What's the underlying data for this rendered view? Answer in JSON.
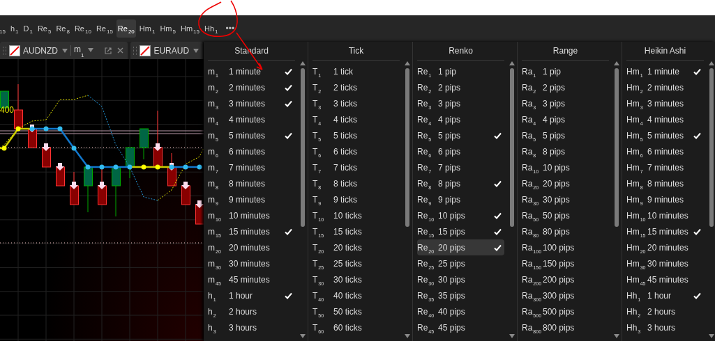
{
  "toolbar": {
    "items": [
      {
        "sub": "15",
        "selected": false
      },
      {
        "prefix": "h",
        "sub": "1",
        "selected": false
      },
      {
        "prefix": "D",
        "sub": "1",
        "selected": false
      },
      {
        "prefix": "Re",
        "sub": "5",
        "selected": false
      },
      {
        "prefix": "Re",
        "sub": "8",
        "selected": false
      },
      {
        "prefix": "Re",
        "sub": "10",
        "selected": false
      },
      {
        "prefix": "Re",
        "sub": "15",
        "selected": false
      },
      {
        "prefix": "Re",
        "sub": "20",
        "selected": true
      },
      {
        "prefix": "Hm",
        "sub": "1",
        "selected": false
      },
      {
        "prefix": "Hm",
        "sub": "5",
        "selected": false
      },
      {
        "prefix": "Hm",
        "sub": "15",
        "selected": false
      },
      {
        "prefix": "Hh",
        "sub": "1",
        "selected": false
      }
    ],
    "more": "•••"
  },
  "chart_tabs": [
    {
      "symbol": "AUDNZD",
      "timeframe_prefix": "m",
      "timeframe_sub": "1"
    },
    {
      "symbol": "EURAUD"
    }
  ],
  "chart": {
    "price_label": "400"
  },
  "menu": {
    "columns": [
      {
        "title": "Standard",
        "items": [
          {
            "prefix": "m",
            "sub": "1",
            "label": "1 minute",
            "checked": true,
            "selected": false
          },
          {
            "prefix": "m",
            "sub": "2",
            "label": "2 minutes",
            "checked": true,
            "selected": false
          },
          {
            "prefix": "m",
            "sub": "3",
            "label": "3 minutes",
            "checked": true,
            "selected": false
          },
          {
            "prefix": "m",
            "sub": "4",
            "label": "4 minutes",
            "checked": false,
            "selected": false
          },
          {
            "prefix": "m",
            "sub": "5",
            "label": "5 minutes",
            "checked": true,
            "selected": false
          },
          {
            "prefix": "m",
            "sub": "6",
            "label": "6 minutes",
            "checked": false,
            "selected": false
          },
          {
            "prefix": "m",
            "sub": "7",
            "label": "7 minutes",
            "checked": false,
            "selected": false
          },
          {
            "prefix": "m",
            "sub": "8",
            "label": "8 minutes",
            "checked": false,
            "selected": false
          },
          {
            "prefix": "m",
            "sub": "9",
            "label": "9 minutes",
            "checked": false,
            "selected": false
          },
          {
            "prefix": "m",
            "sub": "10",
            "label": "10 minutes",
            "checked": false,
            "selected": false
          },
          {
            "prefix": "m",
            "sub": "15",
            "label": "15 minutes",
            "checked": true,
            "selected": false
          },
          {
            "prefix": "m",
            "sub": "20",
            "label": "20 minutes",
            "checked": false,
            "selected": false
          },
          {
            "prefix": "m",
            "sub": "30",
            "label": "30 minutes",
            "checked": false,
            "selected": false
          },
          {
            "prefix": "m",
            "sub": "45",
            "label": "45 minutes",
            "checked": false,
            "selected": false
          },
          {
            "prefix": "h",
            "sub": "1",
            "label": "1 hour",
            "checked": true,
            "selected": false
          },
          {
            "prefix": "h",
            "sub": "2",
            "label": "2 hours",
            "checked": false,
            "selected": false
          },
          {
            "prefix": "h",
            "sub": "3",
            "label": "3 hours",
            "checked": false,
            "selected": false
          }
        ]
      },
      {
        "title": "Tick",
        "items": [
          {
            "prefix": "T",
            "sub": "1",
            "label": "1 tick",
            "checked": false,
            "selected": false
          },
          {
            "prefix": "T",
            "sub": "2",
            "label": "2 ticks",
            "checked": false,
            "selected": false
          },
          {
            "prefix": "T",
            "sub": "3",
            "label": "3 ticks",
            "checked": false,
            "selected": false
          },
          {
            "prefix": "T",
            "sub": "4",
            "label": "4 ticks",
            "checked": false,
            "selected": false
          },
          {
            "prefix": "T",
            "sub": "5",
            "label": "5 ticks",
            "checked": false,
            "selected": false
          },
          {
            "prefix": "T",
            "sub": "6",
            "label": "6 ticks",
            "checked": false,
            "selected": false
          },
          {
            "prefix": "T",
            "sub": "7",
            "label": "7 ticks",
            "checked": false,
            "selected": false
          },
          {
            "prefix": "T",
            "sub": "8",
            "label": "8 ticks",
            "checked": false,
            "selected": false
          },
          {
            "prefix": "T",
            "sub": "9",
            "label": "9 ticks",
            "checked": false,
            "selected": false
          },
          {
            "prefix": "T",
            "sub": "10",
            "label": "10 ticks",
            "checked": false,
            "selected": false
          },
          {
            "prefix": "T",
            "sub": "15",
            "label": "15 ticks",
            "checked": false,
            "selected": false
          },
          {
            "prefix": "T",
            "sub": "20",
            "label": "20 ticks",
            "checked": false,
            "selected": false
          },
          {
            "prefix": "T",
            "sub": "25",
            "label": "25 ticks",
            "checked": false,
            "selected": false
          },
          {
            "prefix": "T",
            "sub": "30",
            "label": "30 ticks",
            "checked": false,
            "selected": false
          },
          {
            "prefix": "T",
            "sub": "40",
            "label": "40 ticks",
            "checked": false,
            "selected": false
          },
          {
            "prefix": "T",
            "sub": "50",
            "label": "50 ticks",
            "checked": false,
            "selected": false
          },
          {
            "prefix": "T",
            "sub": "60",
            "label": "60 ticks",
            "checked": false,
            "selected": false
          }
        ]
      },
      {
        "title": "Renko",
        "items": [
          {
            "prefix": "Re",
            "sub": "1",
            "label": "1 pip",
            "checked": false,
            "selected": false
          },
          {
            "prefix": "Re",
            "sub": "2",
            "label": "2 pips",
            "checked": false,
            "selected": false
          },
          {
            "prefix": "Re",
            "sub": "3",
            "label": "3 pips",
            "checked": false,
            "selected": false
          },
          {
            "prefix": "Re",
            "sub": "4",
            "label": "4 pips",
            "checked": false,
            "selected": false
          },
          {
            "prefix": "Re",
            "sub": "5",
            "label": "5 pips",
            "checked": true,
            "selected": false
          },
          {
            "prefix": "Re",
            "sub": "6",
            "label": "6 pips",
            "checked": false,
            "selected": false
          },
          {
            "prefix": "Re",
            "sub": "7",
            "label": "7 pips",
            "checked": false,
            "selected": false
          },
          {
            "prefix": "Re",
            "sub": "8",
            "label": "8 pips",
            "checked": true,
            "selected": false
          },
          {
            "prefix": "Re",
            "sub": "9",
            "label": "9 pips",
            "checked": false,
            "selected": false
          },
          {
            "prefix": "Re",
            "sub": "10",
            "label": "10 pips",
            "checked": true,
            "selected": false
          },
          {
            "prefix": "Re",
            "sub": "15",
            "label": "15 pips",
            "checked": true,
            "selected": false
          },
          {
            "prefix": "Re",
            "sub": "20",
            "label": "20 pips",
            "checked": true,
            "selected": true
          },
          {
            "prefix": "Re",
            "sub": "25",
            "label": "25 pips",
            "checked": false,
            "selected": false
          },
          {
            "prefix": "Re",
            "sub": "30",
            "label": "30 pips",
            "checked": false,
            "selected": false
          },
          {
            "prefix": "Re",
            "sub": "35",
            "label": "35 pips",
            "checked": false,
            "selected": false
          },
          {
            "prefix": "Re",
            "sub": "40",
            "label": "40 pips",
            "checked": false,
            "selected": false
          },
          {
            "prefix": "Re",
            "sub": "45",
            "label": "45 pips",
            "checked": false,
            "selected": false
          }
        ]
      },
      {
        "title": "Range",
        "items": [
          {
            "prefix": "Ra",
            "sub": "1",
            "label": "1 pip",
            "checked": false,
            "selected": false
          },
          {
            "prefix": "Ra",
            "sub": "2",
            "label": "2 pips",
            "checked": false,
            "selected": false
          },
          {
            "prefix": "Ra",
            "sub": "3",
            "label": "3 pips",
            "checked": false,
            "selected": false
          },
          {
            "prefix": "Ra",
            "sub": "4",
            "label": "4 pips",
            "checked": false,
            "selected": false
          },
          {
            "prefix": "Ra",
            "sub": "5",
            "label": "5 pips",
            "checked": false,
            "selected": false
          },
          {
            "prefix": "Ra",
            "sub": "8",
            "label": "8 pips",
            "checked": false,
            "selected": false
          },
          {
            "prefix": "Ra",
            "sub": "10",
            "label": "10 pips",
            "checked": false,
            "selected": false
          },
          {
            "prefix": "Ra",
            "sub": "20",
            "label": "20 pips",
            "checked": false,
            "selected": false
          },
          {
            "prefix": "Ra",
            "sub": "30",
            "label": "30 pips",
            "checked": false,
            "selected": false
          },
          {
            "prefix": "Ra",
            "sub": "50",
            "label": "50 pips",
            "checked": false,
            "selected": false
          },
          {
            "prefix": "Ra",
            "sub": "80",
            "label": "80 pips",
            "checked": false,
            "selected": false
          },
          {
            "prefix": "Ra",
            "sub": "100",
            "label": "100 pips",
            "checked": false,
            "selected": false
          },
          {
            "prefix": "Ra",
            "sub": "150",
            "label": "150 pips",
            "checked": false,
            "selected": false
          },
          {
            "prefix": "Ra",
            "sub": "200",
            "label": "200 pips",
            "checked": false,
            "selected": false
          },
          {
            "prefix": "Ra",
            "sub": "300",
            "label": "300 pips",
            "checked": false,
            "selected": false
          },
          {
            "prefix": "Ra",
            "sub": "500",
            "label": "500 pips",
            "checked": false,
            "selected": false
          },
          {
            "prefix": "Ra",
            "sub": "800",
            "label": "800 pips",
            "checked": false,
            "selected": false
          }
        ]
      },
      {
        "title": "Heikin Ashi",
        "items": [
          {
            "prefix": "Hm",
            "sub": "1",
            "label": "1 minute",
            "checked": true,
            "selected": false
          },
          {
            "prefix": "Hm",
            "sub": "2",
            "label": "2 minutes",
            "checked": false,
            "selected": false
          },
          {
            "prefix": "Hm",
            "sub": "3",
            "label": "3 minutes",
            "checked": false,
            "selected": false
          },
          {
            "prefix": "Hm",
            "sub": "4",
            "label": "4 minutes",
            "checked": false,
            "selected": false
          },
          {
            "prefix": "Hm",
            "sub": "5",
            "label": "5 minutes",
            "checked": true,
            "selected": false
          },
          {
            "prefix": "Hm",
            "sub": "6",
            "label": "6 minutes",
            "checked": false,
            "selected": false
          },
          {
            "prefix": "Hm",
            "sub": "7",
            "label": "7 minutes",
            "checked": false,
            "selected": false
          },
          {
            "prefix": "Hm",
            "sub": "8",
            "label": "8 minutes",
            "checked": false,
            "selected": false
          },
          {
            "prefix": "Hm",
            "sub": "9",
            "label": "9 minutes",
            "checked": false,
            "selected": false
          },
          {
            "prefix": "Hm",
            "sub": "10",
            "label": "10 minutes",
            "checked": false,
            "selected": false
          },
          {
            "prefix": "Hm",
            "sub": "15",
            "label": "15 minutes",
            "checked": true,
            "selected": false
          },
          {
            "prefix": "Hm",
            "sub": "20",
            "label": "20 minutes",
            "checked": false,
            "selected": false
          },
          {
            "prefix": "Hm",
            "sub": "30",
            "label": "30 minutes",
            "checked": false,
            "selected": false
          },
          {
            "prefix": "Hm",
            "sub": "45",
            "label": "45 minutes",
            "checked": false,
            "selected": false
          },
          {
            "prefix": "Hh",
            "sub": "1",
            "label": "1 hour",
            "checked": true,
            "selected": false
          },
          {
            "prefix": "Hh",
            "sub": "2",
            "label": "2 hours",
            "checked": false,
            "selected": false
          },
          {
            "prefix": "Hh",
            "sub": "3",
            "label": "3 hours",
            "checked": false,
            "selected": false
          }
        ]
      }
    ]
  }
}
